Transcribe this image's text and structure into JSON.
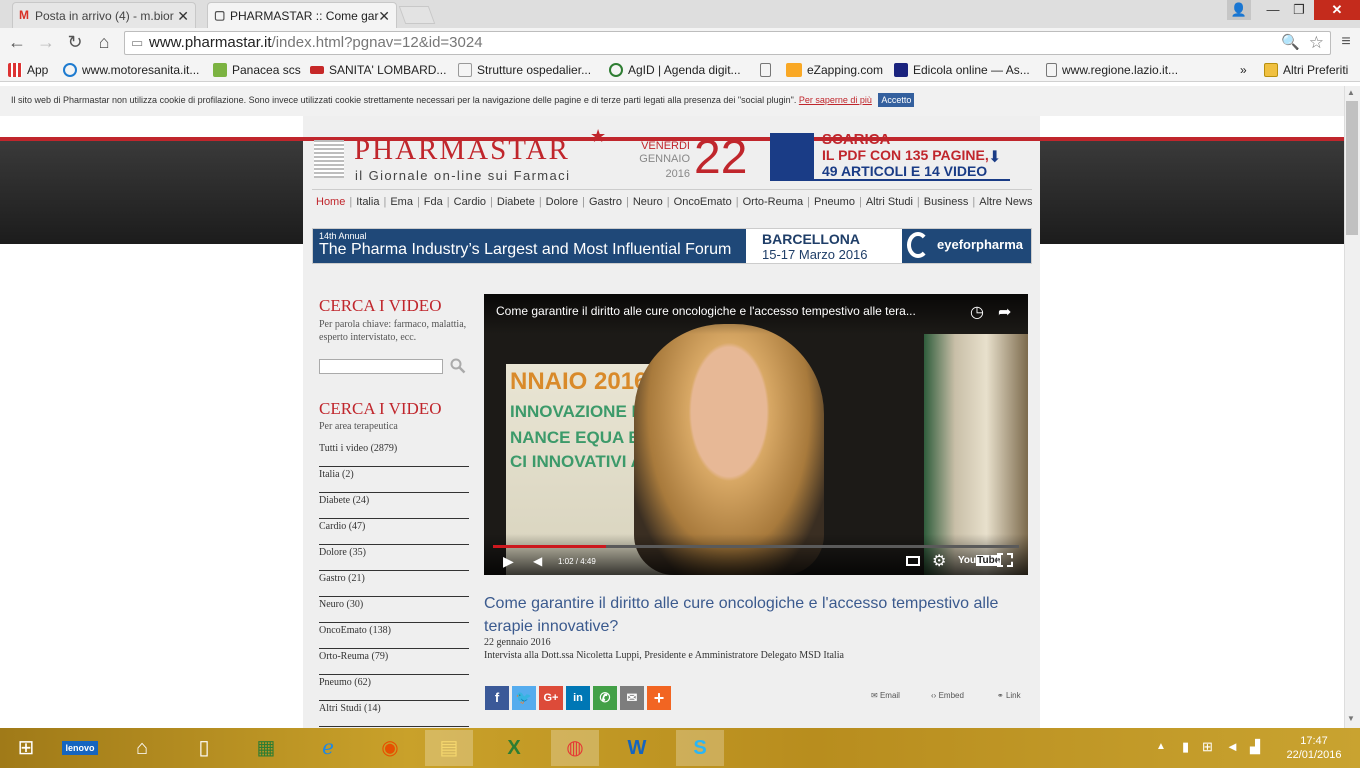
{
  "browser": {
    "tabs": [
      {
        "label": "Posta in arrivo (4) - m.bior",
        "icon": "gmail-icon"
      },
      {
        "label": "PHARMASTAR :: Come gar",
        "icon": "pharmastar-icon"
      }
    ],
    "url_host": "www.pharmastar.it",
    "url_path": "/index.html?pgnav=12&id=3024",
    "bookmarks": [
      {
        "label": "App"
      },
      {
        "label": "www.motoresanita.it..."
      },
      {
        "label": "Panacea scs"
      },
      {
        "label": "SANITA' LOMBARD..."
      },
      {
        "label": "Strutture ospedalier..."
      },
      {
        "label": "AgID | Agenda digit..."
      },
      {
        "label": ""
      },
      {
        "label": "eZapping.com"
      },
      {
        "label": "Edicola online — As..."
      },
      {
        "label": "www.regione.lazio.it..."
      }
    ],
    "bookmarks_more": "»",
    "other_bookmarks": "Altri Preferiti"
  },
  "cookie": {
    "text": "Il sito web di Pharmastar non utilizza cookie di profilazione. Sono invece utilizzati cookie strettamente necessari per la navigazione delle pagine e di terze parti legati alla presenza dei \"social plugin\".",
    "link": "Per saperne di più",
    "accept": "Accetto"
  },
  "header": {
    "logo": "PHARMASTAR",
    "tagline": "il Giornale on-line sui Farmaci",
    "day_name": "VENERDÌ",
    "month": "GENNAIO",
    "year": "2016",
    "day_num": "22",
    "promo_line1": "SCARICA",
    "promo_line2": "IL PDF CON 135 PAGINE,",
    "promo_line3": "49 ARTICOLI E 14 VIDEO"
  },
  "nav": [
    "Home",
    "Italia",
    "Ema",
    "Fda",
    "Cardio",
    "Diabete",
    "Dolore",
    "Gastro",
    "Neuro",
    "OncoEmato",
    "Orto-Reuma",
    "Pneumo",
    "Altri Studi",
    "Business",
    "Altre News"
  ],
  "banner": {
    "annual": "14th Annual",
    "headline": "The Pharma Industry’s Largest and Most Influential Forum",
    "city": "BARCELLONA",
    "dates": "15-17 Marzo 2016",
    "brand": "eyeforpharma"
  },
  "sidebar": {
    "search_title": "CERCA I VIDEO",
    "search_sub": "Per parola chiave: farmaco, malattia, esperto intervistato, ecc.",
    "area_title": "CERCA I VIDEO",
    "area_sub": "Per area terapeutica",
    "categories": [
      "Tutti i video (2879)",
      "Italia (2)",
      "Diabete (24)",
      "Cardio (47)",
      "Dolore (35)",
      "Gastro (21)",
      "Neuro (30)",
      "OncoEmato (138)",
      "Orto-Reuma (79)",
      "Pneumo (62)",
      "Altri Studi (14)"
    ]
  },
  "video": {
    "title": "Come garantire il diritto alle cure oncologiche e l'accesso tempestivo alle tera...",
    "time": "1:02 / 4:49",
    "progress": 0.215,
    "bg_text_1": "NNAIO 2016 WO",
    "bg_text_2": "INNOVAZIONE  FA",
    "bg_text_3": "NANCE EQUA E SOS",
    "bg_text_4": "CI INNOVATIVI A"
  },
  "article": {
    "title": "Come garantire il diritto alle cure oncologiche e l'accesso tempestivo alle terapie innovative?",
    "date": "22 gennaio 2016",
    "desc": "Intervista alla Dott.ssa Nicoletta Luppi, Presidente e Amministratore Delegato MSD Italia",
    "share_email": "Email",
    "share_embed": "Embed",
    "share_link": "Link"
  },
  "taskbar": {
    "time": "17:47",
    "date": "22/01/2016"
  },
  "colors": {
    "brand_red": "#c0262c",
    "link_blue": "#3b5a8e",
    "facebook": "#3b5998",
    "twitter": "#55acee",
    "googleplus": "#dd4b39",
    "linkedin": "#0077b5",
    "whatsapp": "#43a047",
    "email": "#7d7d7d",
    "more": "#f26522"
  }
}
